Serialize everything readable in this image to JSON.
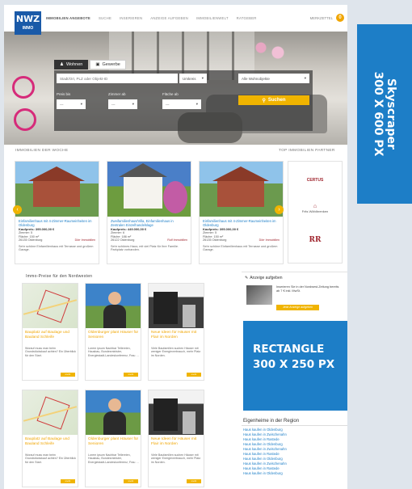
{
  "skyscraper": {
    "line1": "Skyscraper",
    "line2": "300 X 600 PX"
  },
  "logo": {
    "main": "NWZ",
    "sub": "IMMO"
  },
  "nav": {
    "items": [
      "IMMOBILIEN ANGEBOTE",
      "SUCHE",
      "INSERIEREN",
      "ANZEIGE AUFGEBEN",
      "IMMOBILIENWELT",
      "RATGEBER"
    ],
    "right_label": "MERKZETTEL",
    "badge": "0"
  },
  "search": {
    "tab_wohnen": "Wohnen",
    "tab_gewerbe": "Gewerbe",
    "placeholder": "Stadt/Ort, PLZ oder Objekt-ID",
    "umkreis": "Umkreis",
    "type": "Alle Wohnobjekte",
    "label_preis": "Preis bis",
    "label_zimmer": "Zimmer ab",
    "label_flaeche": "Fläche ab",
    "preis": "---",
    "zimmer": "---",
    "flaeche": "---",
    "button": "Suchen"
  },
  "sections": {
    "week": "IMMOBILIEN DER WOCHE",
    "partner": "TOP IMMOBILIEN PARTNER",
    "prices": "Immo-Preise für den Nordwesten"
  },
  "properties": [
    {
      "title": "Einfamilienhaus mit 4-Zimmer-Raumeinheiten im Oldenburg",
      "price": "Kaufpreis: 395.000,00 €",
      "rooms": "Zimmer: 5",
      "area": "Fläche: 150 m²",
      "city": "26135 Oldenburg",
      "desc": "Sehr schöne Einfamilienhaus mit Terrasse und großem Garage.",
      "agent": "Dörr Immobilien"
    },
    {
      "title": "Zweifamilienhaus/Villa, Einfamilienhaus in Zentralen Einzelhandelslage",
      "price": "Kaufpreis: 449.000,00 €",
      "rooms": "Zimmer: 6",
      "area": "Fläche: 186 m²",
      "city": "26122 Oldenburg",
      "desc": "Sehr schönes Haus; mit viel Platz für Ihre Familie. Parkplatz vorhanden.",
      "agent": "Rolf Immobilien"
    },
    {
      "title": "Einfamilienhaus mit 4-Zimmer-Raumeinheiten im Oldenburg",
      "price": "Kaufpreis: 395.000,00 €",
      "rooms": "Zimmer: 5",
      "area": "Fläche: 150 m²",
      "city": "26135 Oldenburg",
      "desc": "Sehr schöne Einfamilienhaus mit Terrasse und großem Garage.",
      "agent": "Dörr Immobilien"
    }
  ],
  "partners": {
    "p1": "CERTUS",
    "p2": "Frits Wählbrenken",
    "p3": "RR"
  },
  "price_cards": [
    {
      "title": "Bauplatz auf Baulage und Bauland Schleife",
      "text": "Worauf muss man beim Grundstückskauf achten? Ein Überblick für den Start.",
      "button": "mehr"
    },
    {
      "title": "Oldenburger plant Häuser für Senioren",
      "text": "Lorem ipsum Nachbar Tellereien, Hausbau, Bundesminister, Energiestadt-Landeskonferenz, Frau …",
      "button": "mehr"
    },
    {
      "title": "Neue Ideen für Häuser mit Flair im Norden",
      "text": "Viele Baufamilien suchen Häuser mit weniger Energieverbrauch, mehr Platz im Norden.",
      "button": "mehr"
    },
    {
      "title": "Bauplatz auf Baulage und Bauland Schleife",
      "text": "Worauf muss man beim Grundstückskauf achten? Ein Überblick für den Start.",
      "button": "mehr"
    },
    {
      "title": "Oldenburger plant Häuser für Senioren",
      "text": "Lorem ipsum Nachbar Tellereien, Hausbau, Bundesminister, Energiestadt-Landeskonferenz, Frau …",
      "button": "mehr"
    },
    {
      "title": "Neue Ideen für Häuser mit Flair im Norden",
      "text": "Viele Baufamilien suchen Häuser mit weniger Energieverbrauch, mehr Platz im Norden.",
      "button": "mehr"
    }
  ],
  "sidebar": {
    "ad_title": "Anzeige aufgeben",
    "ad_text": "Inserieren Sie in der Nordwest-Zeitung bereits ab 7 € inkl. MwSt.",
    "ad_button": "Jetzt Anzeige aufgeben",
    "rect_line1": "RECTANGLE",
    "rect_line2": "300 X 250 PX",
    "region_title": "Eigenheime in der Region",
    "region_links": [
      "Haus kaufen in Oldenburg",
      "Haus kaufen in Zwischenahn",
      "Haus kaufen in Rastede",
      "Haus kaufen in Oldenburg",
      "Haus kaufen in Zwischenahn",
      "Haus kaufen in Rastede",
      "Haus kaufen in Oldenburg",
      "Haus kaufen in Zwischenahn",
      "Haus kaufen in Rastede",
      "Haus kaufen in Oldenburg"
    ]
  }
}
